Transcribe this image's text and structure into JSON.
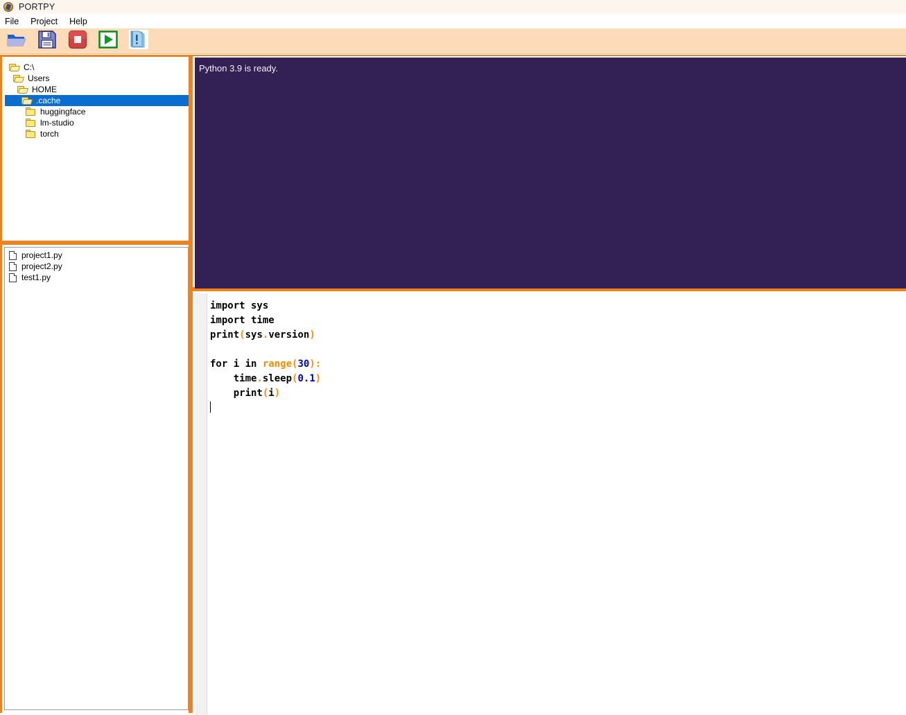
{
  "window": {
    "title": "PORTPY",
    "app_icon": "compass-icon"
  },
  "menubar": {
    "items": [
      {
        "label": "File",
        "name": "menu-file"
      },
      {
        "label": "Project",
        "name": "menu-project"
      },
      {
        "label": "Help",
        "name": "menu-help"
      }
    ]
  },
  "toolbar": {
    "buttons": [
      {
        "name": "open-folder-button",
        "icon": "folder-open-icon",
        "title": "Open"
      },
      {
        "name": "save-button",
        "icon": "floppy-disk-icon",
        "title": "Save"
      },
      {
        "name": "stop-button",
        "icon": "stop-icon",
        "title": "Stop"
      },
      {
        "name": "run-button",
        "icon": "play-icon",
        "title": "Run"
      },
      {
        "name": "error-log-button",
        "icon": "document-warning-icon",
        "title": "Errors"
      }
    ]
  },
  "tree": {
    "items": [
      {
        "label": "C:\\",
        "depth": 0,
        "icon": "folder-open-icon",
        "selected": false
      },
      {
        "label": "Users",
        "depth": 1,
        "icon": "folder-open-icon",
        "selected": false
      },
      {
        "label": "HOME",
        "depth": 2,
        "icon": "folder-open-icon",
        "selected": false
      },
      {
        "label": ".cache",
        "depth": 3,
        "icon": "folder-open-icon",
        "selected": true
      },
      {
        "label": "huggingface",
        "depth": 4,
        "icon": "folder-closed-icon",
        "selected": false
      },
      {
        "label": "lm-studio",
        "depth": 4,
        "icon": "folder-closed-icon",
        "selected": false
      },
      {
        "label": "torch",
        "depth": 4,
        "icon": "folder-closed-icon",
        "selected": false
      }
    ]
  },
  "files": {
    "items": [
      {
        "label": "project1.py",
        "icon": "page-icon"
      },
      {
        "label": "project2.py",
        "icon": "page-icon"
      },
      {
        "label": "test1.py",
        "icon": "page-icon"
      }
    ]
  },
  "console": {
    "text": "Python 3.9 is ready."
  },
  "editor": {
    "lines": [
      [
        {
          "t": "import sys",
          "c": "plain"
        }
      ],
      [
        {
          "t": "import time",
          "c": "plain"
        }
      ],
      [
        {
          "t": "print",
          "c": "plain"
        },
        {
          "t": "(",
          "c": "punc"
        },
        {
          "t": "sys",
          "c": "plain"
        },
        {
          "t": ".",
          "c": "punc"
        },
        {
          "t": "version",
          "c": "plain"
        },
        {
          "t": ")",
          "c": "punc"
        }
      ],
      [
        {
          "t": "",
          "c": "plain"
        }
      ],
      [
        {
          "t": "for i in ",
          "c": "plain"
        },
        {
          "t": "range",
          "c": "fn"
        },
        {
          "t": "(",
          "c": "punc"
        },
        {
          "t": "30",
          "c": "num"
        },
        {
          "t": ")",
          "c": "punc"
        },
        {
          "t": ":",
          "c": "punc"
        }
      ],
      [
        {
          "t": "    time",
          "c": "plain"
        },
        {
          "t": ".",
          "c": "punc"
        },
        {
          "t": "sleep",
          "c": "plain"
        },
        {
          "t": "(",
          "c": "punc"
        },
        {
          "t": "0.1",
          "c": "num"
        },
        {
          "t": ")",
          "c": "punc"
        }
      ],
      [
        {
          "t": "    print",
          "c": "plain"
        },
        {
          "t": "(",
          "c": "punc"
        },
        {
          "t": "i",
          "c": "plain"
        },
        {
          "t": ")",
          "c": "punc"
        }
      ],
      [
        {
          "t": "",
          "c": "caret"
        }
      ]
    ]
  },
  "colors": {
    "accent_orange": "#f0821e",
    "toolbar_bg": "#fcdcb8",
    "console_bg": "#332054",
    "selection_blue": "#0a6ed1",
    "syntax_punct": "#ff8c00",
    "syntax_number": "#0000cc",
    "folder_yellow": "#fbe87d"
  }
}
